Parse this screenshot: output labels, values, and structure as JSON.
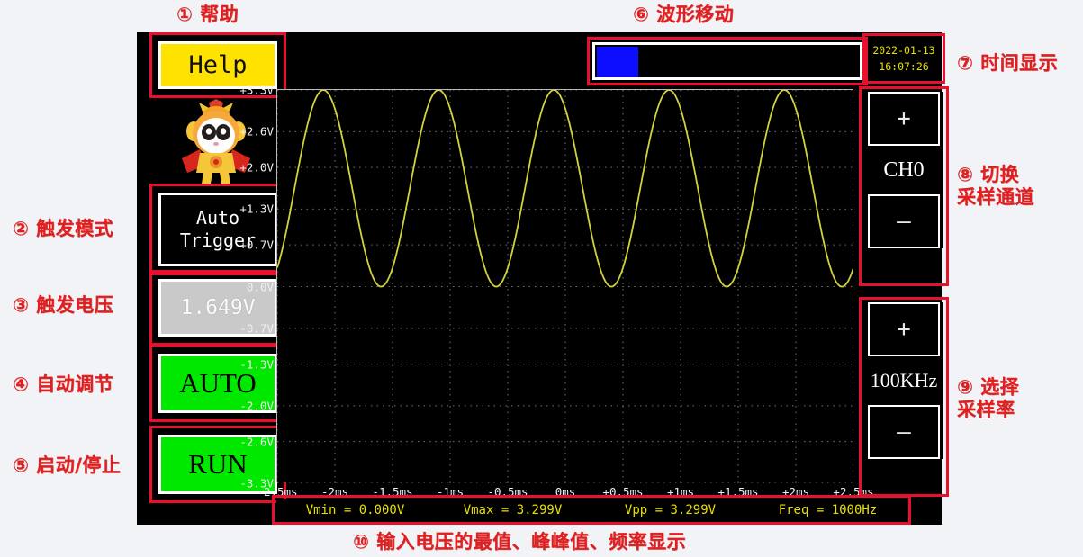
{
  "annotations": [
    {
      "id": "help",
      "num": "①",
      "text": "帮助"
    },
    {
      "id": "trigger-mode",
      "num": "②",
      "text": "触发模式"
    },
    {
      "id": "trigger-volt",
      "num": "③",
      "text": "触发电压"
    },
    {
      "id": "auto-adjust",
      "num": "④",
      "text": "自动调节"
    },
    {
      "id": "run-stop",
      "num": "⑤",
      "text": "启动/停止"
    },
    {
      "id": "wave-move",
      "num": "⑥",
      "text": "波形移动"
    },
    {
      "id": "time-display",
      "num": "⑦",
      "text": "时间显示"
    },
    {
      "id": "switch-ch",
      "num": "⑧",
      "text": "切换",
      "text2": "采样通道"
    },
    {
      "id": "sample-rate",
      "num": "⑨",
      "text": "选择",
      "text2": "采样率"
    },
    {
      "id": "measurements",
      "num": "⑩",
      "text": "输入电压的最值、峰峰值、频率显示"
    }
  ],
  "device": {
    "help_button": "Help",
    "mascot": "monkey-mascot",
    "trigger_mode": {
      "line1": "Auto",
      "line2": "Trigger"
    },
    "trigger_voltage": "1.649V",
    "auto_button": "AUTO",
    "run_button": "RUN",
    "clock": {
      "date": "2022-01-13",
      "time": "16:07:26"
    },
    "channel_stepper": {
      "plus": "+",
      "value": "CH0",
      "minus": "—"
    },
    "rate_stepper": {
      "plus": "+",
      "value": "100KHz",
      "minus": "—"
    },
    "measurements": [
      "Vmin = 0.000V",
      "Vmax = 3.299V",
      "Vpp = 3.299V",
      "Freq = 1000Hz"
    ]
  },
  "colors": {
    "trace": "#d2d23c",
    "accent_red": "#e8112d",
    "green": "#00e800",
    "yellow": "#ffe200",
    "clock_text": "#e8e000",
    "scroll_thumb": "#0d0dff"
  },
  "chart_data": {
    "type": "line",
    "title": "",
    "xlabel": "",
    "ylabel": "",
    "grid": true,
    "legend": false,
    "xlim": [
      -2.5,
      2.5
    ],
    "ylim": [
      -3.3,
      3.3
    ],
    "xtick_labels": [
      "-2.5ms",
      "-2ms",
      "-1.5ms",
      "-1ms",
      "-0.5ms",
      "0ms",
      "+0.5ms",
      "+1ms",
      "+1.5ms",
      "+2ms",
      "+2.5ms"
    ],
    "xticks": [
      -2.5,
      -2.0,
      -1.5,
      -1.0,
      -0.5,
      0,
      0.5,
      1.0,
      1.5,
      2.0,
      2.5
    ],
    "ytick_labels": [
      "+3.3V",
      "+2.6V",
      "+2.0V",
      "+1.3V",
      "+0.7V",
      "0.0V",
      "-0.7V",
      "-1.3V",
      "-2.0V",
      "-2.6V",
      "-3.3V"
    ],
    "yticks": [
      3.3,
      2.6,
      2.0,
      1.3,
      0.7,
      0.0,
      -0.7,
      -1.3,
      -2.0,
      -2.6,
      -3.3
    ],
    "series": [
      {
        "name": "CH0",
        "color": "#d2d23c",
        "waveform": "sine",
        "frequency_hz": 1000,
        "amplitude_v": 1.6495,
        "offset_v": 1.6495,
        "phase_deg": 126,
        "vmin": 0.0,
        "vmax": 3.299
      }
    ]
  }
}
